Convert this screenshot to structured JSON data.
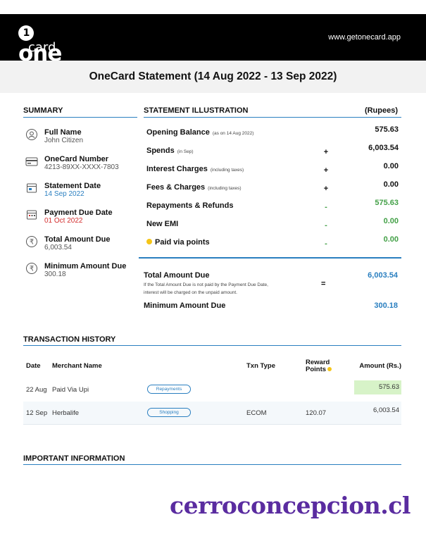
{
  "header": {
    "logo_one": "one",
    "logo_card": "card",
    "website": "www.getonecard.app"
  },
  "title": "OneCard Statement (14 Aug 2022 - 13 Sep 2022)",
  "summary": {
    "heading": "SUMMARY",
    "items": [
      {
        "label": "Full Name",
        "value": "John Citizen",
        "icon": "user-icon"
      },
      {
        "label": "OneCard Number",
        "value": "4213-89XX-XXXX-7803",
        "icon": "card-icon"
      },
      {
        "label": "Statement Date",
        "value": "14 Sep 2022",
        "icon": "statement-icon"
      },
      {
        "label": "Payment Due Date",
        "value": "01 Oct 2022",
        "icon": "calendar-icon"
      },
      {
        "label": "Total Amount Due",
        "value": "6,003.54",
        "icon": "rupee-icon"
      },
      {
        "label": "Minimum Amount Due",
        "value": "300.18",
        "icon": "rupee-icon"
      }
    ]
  },
  "illustration": {
    "heading": "STATEMENT ILLUSTRATION",
    "unit": "(Rupees)",
    "rows": [
      {
        "label": "Opening Balance",
        "sub": "(as on 14 Aug 2022)",
        "op": "",
        "amount": "575.63"
      },
      {
        "label": "Spends",
        "sub": "(in Sep)",
        "op": "+",
        "amount": "6,003.54"
      },
      {
        "label": "Interest Charges",
        "sub": "(including taxes)",
        "op": "+",
        "amount": "0.00"
      },
      {
        "label": "Fees & Charges",
        "sub": "(including taxes)",
        "op": "+",
        "amount": "0.00"
      },
      {
        "label": "Repayments & Refunds",
        "sub": "",
        "op": "-",
        "amount": "575.63"
      },
      {
        "label": "New EMI",
        "sub": "",
        "op": "-",
        "amount": "0.00"
      },
      {
        "label": "Paid via points",
        "sub": "",
        "op": "-",
        "amount": "0.00"
      }
    ],
    "total_label": "Total Amount Due",
    "total_note": "If the Total Amount Due is not paid by the Payment Due Date, interest will be charged on the unpaid amount.",
    "total_op": "=",
    "total_amount": "6,003.54",
    "min_label": "Minimum Amount Due",
    "min_amount": "300.18"
  },
  "transactions": {
    "heading": "TRANSACTION HISTORY",
    "columns": {
      "date": "Date",
      "merchant": "Merchant Name",
      "txn_type": "Txn Type",
      "reward": "Reward Points",
      "amount": "Amount (Rs.)"
    },
    "rows": [
      {
        "date": "22 Aug",
        "merchant": "Paid Via Upi",
        "category": "Repayments",
        "txn_type": "",
        "reward": "",
        "amount": "575.63"
      },
      {
        "date": "12 Sep",
        "merchant": "Herbalife",
        "category": "Shopping",
        "txn_type": "ECOM",
        "reward": "120.07",
        "amount": "6,003.54"
      }
    ]
  },
  "important": {
    "heading": "IMPORTANT INFORMATION"
  },
  "watermark": "cerroconcepcion.cl",
  "colors": {
    "accent": "#2a7fc0",
    "green": "#43a047",
    "red": "#d32f2f",
    "highlight": "#d7f3c8",
    "watermark": "#5a2ca0"
  }
}
